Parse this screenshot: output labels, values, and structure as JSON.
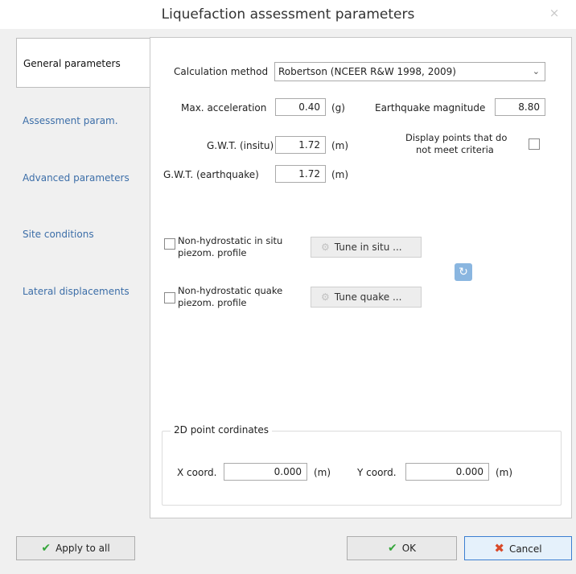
{
  "window": {
    "title": "Liquefaction assessment parameters",
    "close": "×"
  },
  "tabs": [
    {
      "label": "General parameters"
    },
    {
      "label": "Assessment param."
    },
    {
      "label": "Advanced parameters"
    },
    {
      "label": "Site conditions"
    },
    {
      "label": "Lateral displacements"
    }
  ],
  "general": {
    "calc_method_label": "Calculation method",
    "calc_method_value": "Robertson (NCEER R&W 1998, 2009)",
    "max_acc_label": "Max. acceleration",
    "max_acc_value": "0.40",
    "max_acc_unit": "(g)",
    "eq_mag_label": "Earthquake magnitude",
    "eq_mag_value": "8.80",
    "gwt_insitu_label": "G.W.T. (insitu)",
    "gwt_insitu_value": "1.72",
    "gwt_insitu_unit": "(m)",
    "gwt_eq_label": "G.W.T. (earthquake)",
    "gwt_eq_value": "1.72",
    "gwt_eq_unit": "(m)",
    "display_points_line1": "Display points that do",
    "display_points_line2": "not meet criteria",
    "nonhydro_insitu_line1": "Non-hydrostatic in situ",
    "nonhydro_insitu_line2": "piezom. profile",
    "tune_insitu": "Tune in situ ...",
    "nonhydro_quake_line1": "Non-hydrostatic quake",
    "nonhydro_quake_line2": "piezom. profile",
    "tune_quake": "Tune quake ..."
  },
  "coords": {
    "group_title": "2D point cordinates",
    "x_label": "X coord.",
    "x_value": "0.000",
    "x_unit": "(m)",
    "y_label": "Y coord.",
    "y_value": "0.000",
    "y_unit": "(m)"
  },
  "footer": {
    "apply_all": "Apply to all",
    "ok": "OK",
    "cancel": "Cancel"
  }
}
